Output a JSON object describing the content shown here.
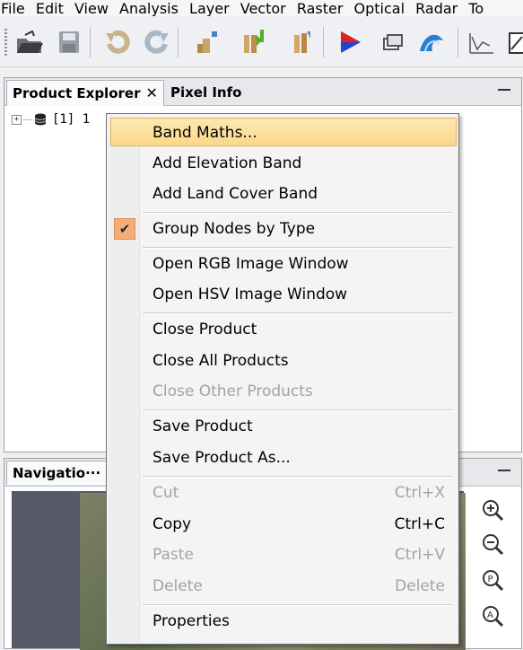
{
  "menubar": [
    "File",
    "Edit",
    "View",
    "Analysis",
    "Layer",
    "Vector",
    "Raster",
    "Optical",
    "Radar",
    "To"
  ],
  "toolbar": {
    "icons": [
      "open-product-icon",
      "save-product-icon",
      "undo-icon",
      "redo-icon",
      "import-raster-icon",
      "band-import-icon",
      "band-subset-icon",
      "color-manipulation-icon",
      "tile-windows-icon",
      "wave-icon",
      "spectrum-icon",
      "range-finder-icon"
    ]
  },
  "explorer": {
    "tab_label": "Product Explorer",
    "tab_close": "✕",
    "pixel_tab": "Pixel Info",
    "tree_item": "[1]  1"
  },
  "nav": {
    "tab_label": "Navigatio··· ✕"
  },
  "context_menu": {
    "items": {
      "band_maths": "Band Maths...",
      "add_elevation": "Add Elevation Band",
      "add_land_cover": "Add Land Cover Band",
      "group_nodes": "Group Nodes by Type",
      "open_rgb": "Open RGB Image Window",
      "open_hsv": "Open HSV Image Window",
      "close_product": "Close Product",
      "close_all": "Close All Products",
      "close_other": "Close Other Products",
      "save_product": "Save Product",
      "save_as": "Save Product As...",
      "cut": "Cut",
      "cut_sc": "Ctrl+X",
      "copy": "Copy",
      "copy_sc": "Ctrl+C",
      "paste": "Paste",
      "paste_sc": "Ctrl+V",
      "delete": "Delete",
      "delete_sc": "Delete",
      "properties": "Properties"
    },
    "group_nodes_checked": true,
    "highlight_color": "#fbd889",
    "check_color": "#f3ad79"
  }
}
